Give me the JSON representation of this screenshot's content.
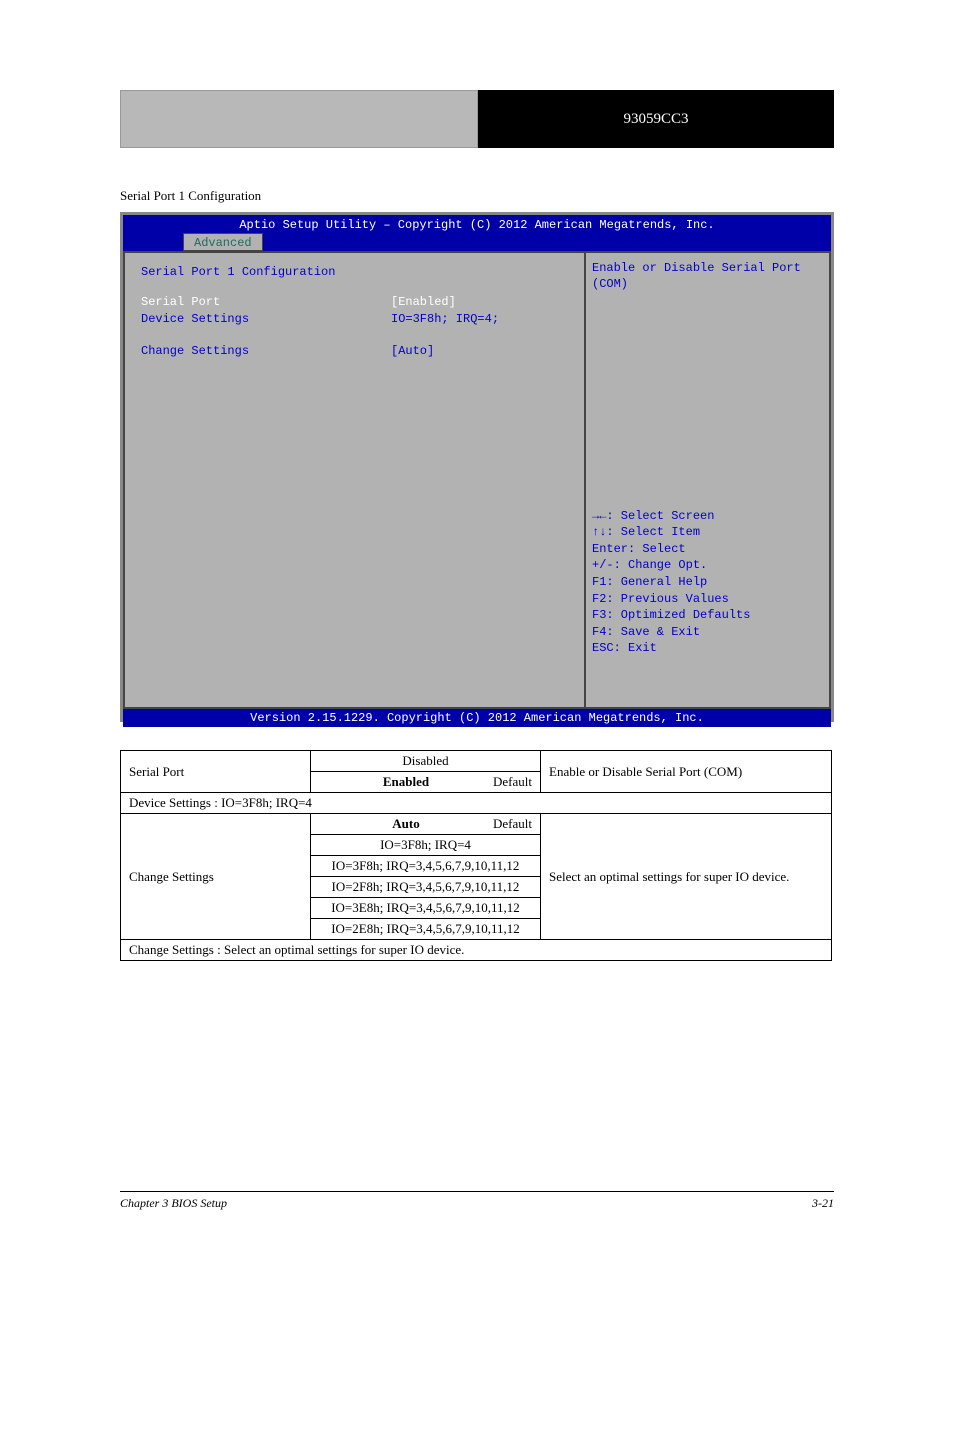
{
  "header": {
    "right_label": "93059CC3"
  },
  "section_heading": "Serial Port 1 Configuration",
  "bios": {
    "title": "Aptio Setup Utility – Copyright (C) 2012 American Megatrends, Inc.",
    "tab": "Advanced",
    "heading": "Serial Port 1 Configuration",
    "rows": [
      {
        "label": "Serial Port",
        "value": "[Enabled]",
        "interactive": true
      },
      {
        "label": "Device Settings",
        "value": "IO=3F8h; IRQ=4;",
        "interactive": false
      }
    ],
    "change_label": "Change Settings",
    "change_value": "[Auto]",
    "help_top": [
      "Enable or Disable Serial Port",
      "(COM)"
    ],
    "keys": [
      "→←: Select Screen",
      "↑↓: Select Item",
      "Enter: Select",
      "+/-: Change Opt.",
      "F1: General Help",
      "F2: Previous Values",
      "F3: Optimized Defaults",
      "F4: Save & Exit",
      "ESC: Exit"
    ],
    "footer": "Version 2.15.1229. Copyright (C) 2012 American Megatrends, Inc."
  },
  "table": {
    "serial_port": {
      "label": "Serial Port",
      "options": [
        "Disabled",
        "Enabled"
      ],
      "default_hint": "Default",
      "desc": "Enable or Disable Serial Port (COM)"
    },
    "device_settings_label": "Device Settings : IO=3F8h; IRQ=4",
    "change_settings": {
      "label": "Change Settings",
      "options": [
        "Auto",
        "IO=3F8h; IRQ=4",
        "IO=3F8h; IRQ=3,4,5,6,7,9,10,11,12",
        "IO=2F8h; IRQ=3,4,5,6,7,9,10,11,12",
        "IO=3E8h; IRQ=3,4,5,6,7,9,10,11,12",
        "IO=2E8h; IRQ=3,4,5,6,7,9,10,11,12"
      ],
      "default_hint": "Default",
      "desc": "Select an optimal settings for super IO device."
    },
    "change_settings_note": "Change Settings : Select an optimal settings for super IO device."
  },
  "footer": {
    "left": "Chapter 3 BIOS Setup",
    "right": "3-21"
  }
}
